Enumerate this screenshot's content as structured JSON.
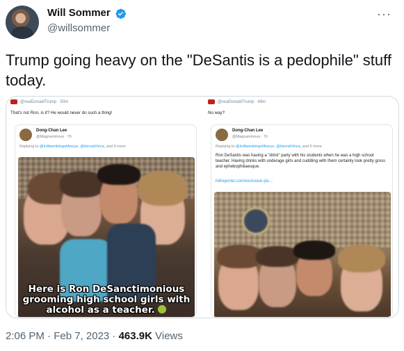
{
  "author": {
    "name": "Will Sommer",
    "handle": "@willsommer",
    "verified_color": "#1d9bf0"
  },
  "menu_icon": "more-horizontal-icon",
  "tweet": {
    "text": "Trump going heavy on the \"DeSantis is a pedophile\" stuff today."
  },
  "media": {
    "left": {
      "header": "@realDonaldTrump · 50m",
      "text": "That's not Ron, is it? He would never do such a thing!",
      "quoted": {
        "name": "Dong-Chan Lee",
        "handle": "@Magnanimous · 7h",
        "reply_prefix": "Replying to ",
        "reply_links": "@InAtwinklingofAneye, @HerratVinca",
        "reply_suffix": ", and 4 more",
        "caption_line1": "Here is Ron DeSanctimonious",
        "caption_line2": "grooming high school girls with",
        "caption_line3": "alcohol as a teacher."
      }
    },
    "right": {
      "header": "@realDonaldTrump · 49m",
      "text": "No way?",
      "quoted": {
        "name": "Dong-Chan Lee",
        "handle": "@Magnanimous · 7h",
        "reply_prefix": "Replying to ",
        "reply_links": "@InAtwinklingofAneye, @HerratVinca",
        "reply_suffix": ", and 5 more",
        "body": "Ron DeSantis was having a \"drink\" party with his students when he was a high school teacher. Having drinks with underage girls and cuddling with them certainly look pretty gross and ephebophiliaesque.",
        "link": "hillreporter.com/exclusive-pic..."
      }
    }
  },
  "meta": {
    "time": "2:06 PM · Feb 7, 2023 · ",
    "views_count": "463.9K",
    "views_label": " Views"
  }
}
